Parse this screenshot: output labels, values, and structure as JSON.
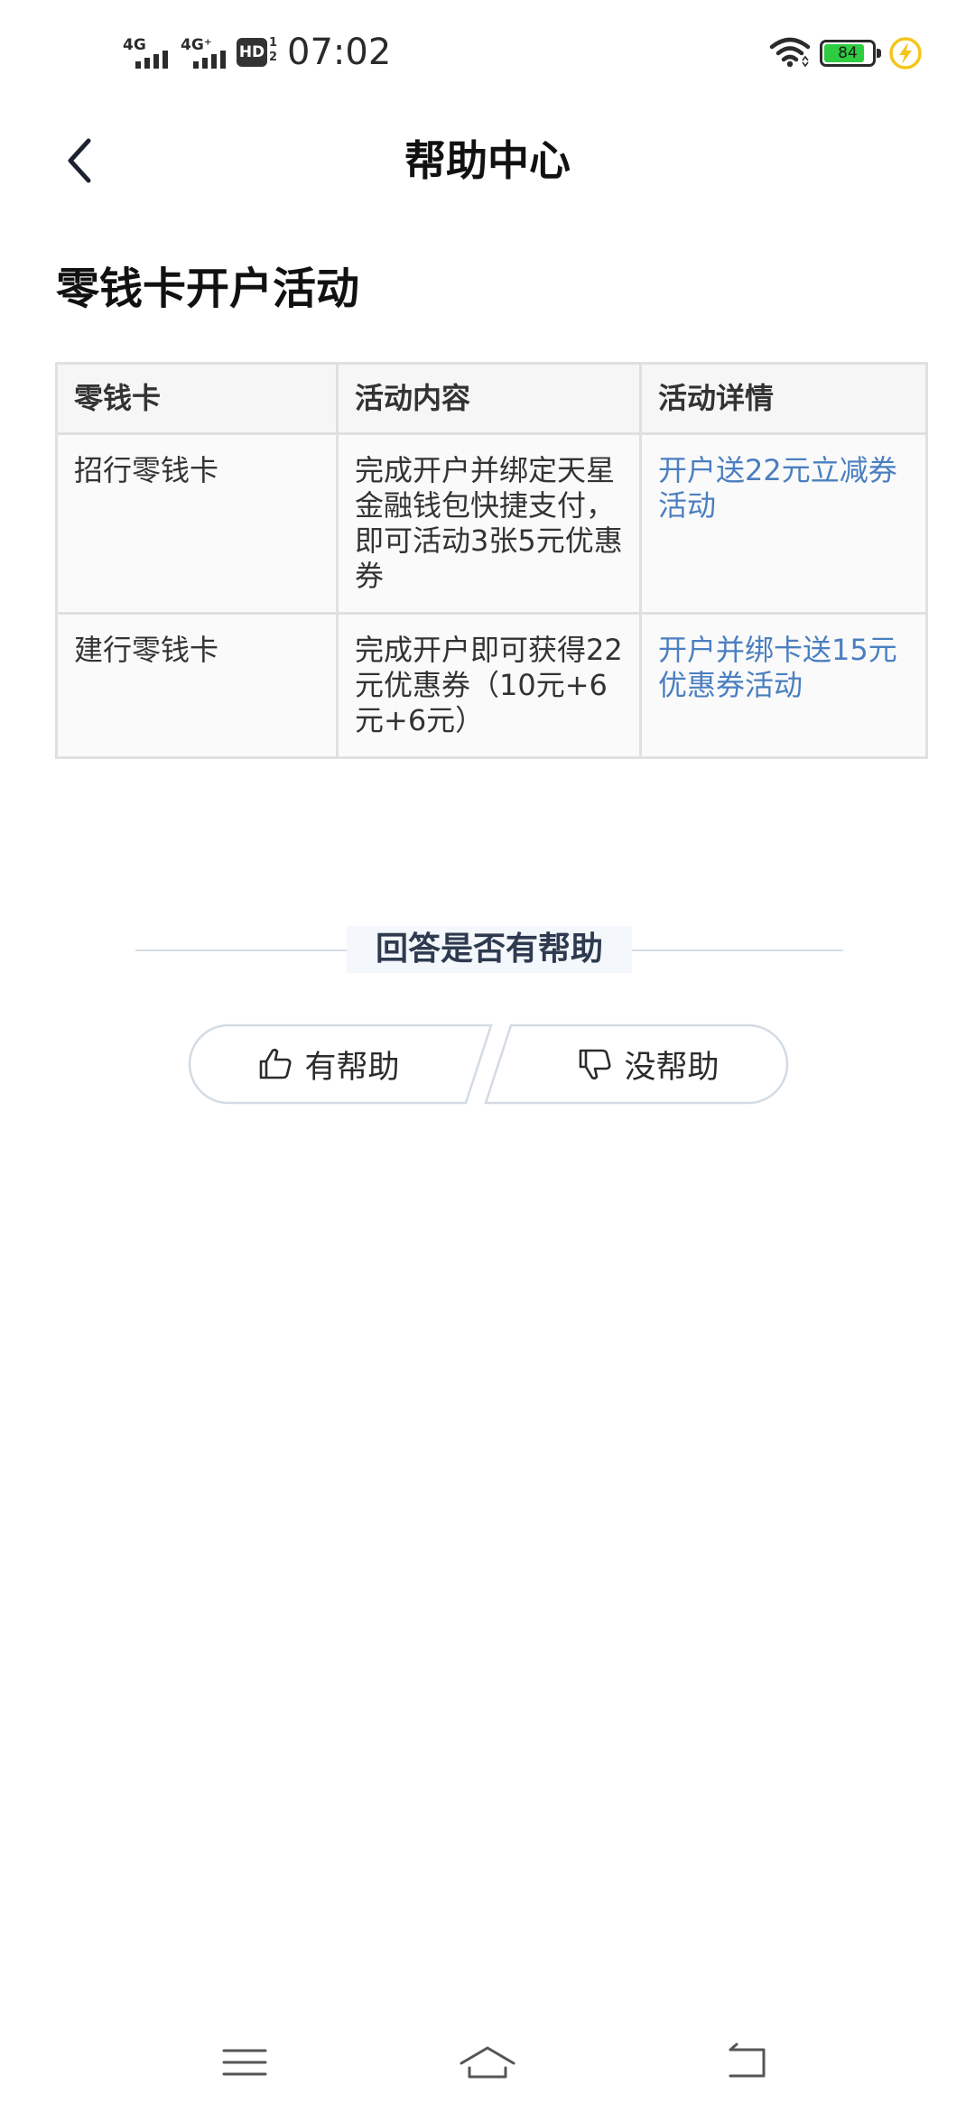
{
  "status_bar": {
    "sim1_label": "4G",
    "sim2_label": "4G⁺",
    "hd_label": "HD",
    "hd_sub": "1\n2",
    "time": "07:02",
    "battery_level": "84",
    "battery_fraction": 0.84,
    "icons": [
      "signal-icon",
      "signal-icon",
      "hd-icon",
      "wifi-icon",
      "battery-icon",
      "charging-icon"
    ]
  },
  "header": {
    "title": "帮助中心",
    "back_icon": "chevron-left-icon"
  },
  "article": {
    "title": "零钱卡开户活动",
    "table": {
      "headers": [
        "零钱卡",
        "活动内容",
        "活动详情"
      ],
      "rows": [
        {
          "card": "招行零钱卡",
          "content": "完成开户并绑定天星金融钱包快捷支付，即可活动3张5元优惠券",
          "detail": "开户送22元立减券活动"
        },
        {
          "card": "建行零钱卡",
          "content": "完成开户即可获得22元优惠券（10元+6元+6元）",
          "detail": "开户并绑卡送15元优惠券活动"
        }
      ]
    }
  },
  "feedback": {
    "title": "回答是否有帮助",
    "helpful_label": "有帮助",
    "not_helpful_label": "没帮助",
    "helpful_icon": "thumbs-up-icon",
    "not_helpful_icon": "thumbs-down-icon"
  },
  "bottom_nav": {
    "icons": [
      "menu-icon",
      "home-icon",
      "back-icon"
    ]
  },
  "colors": {
    "link": "#4a7fc0",
    "battery_fill": "#2ecc40",
    "charging": "#f5c518"
  }
}
